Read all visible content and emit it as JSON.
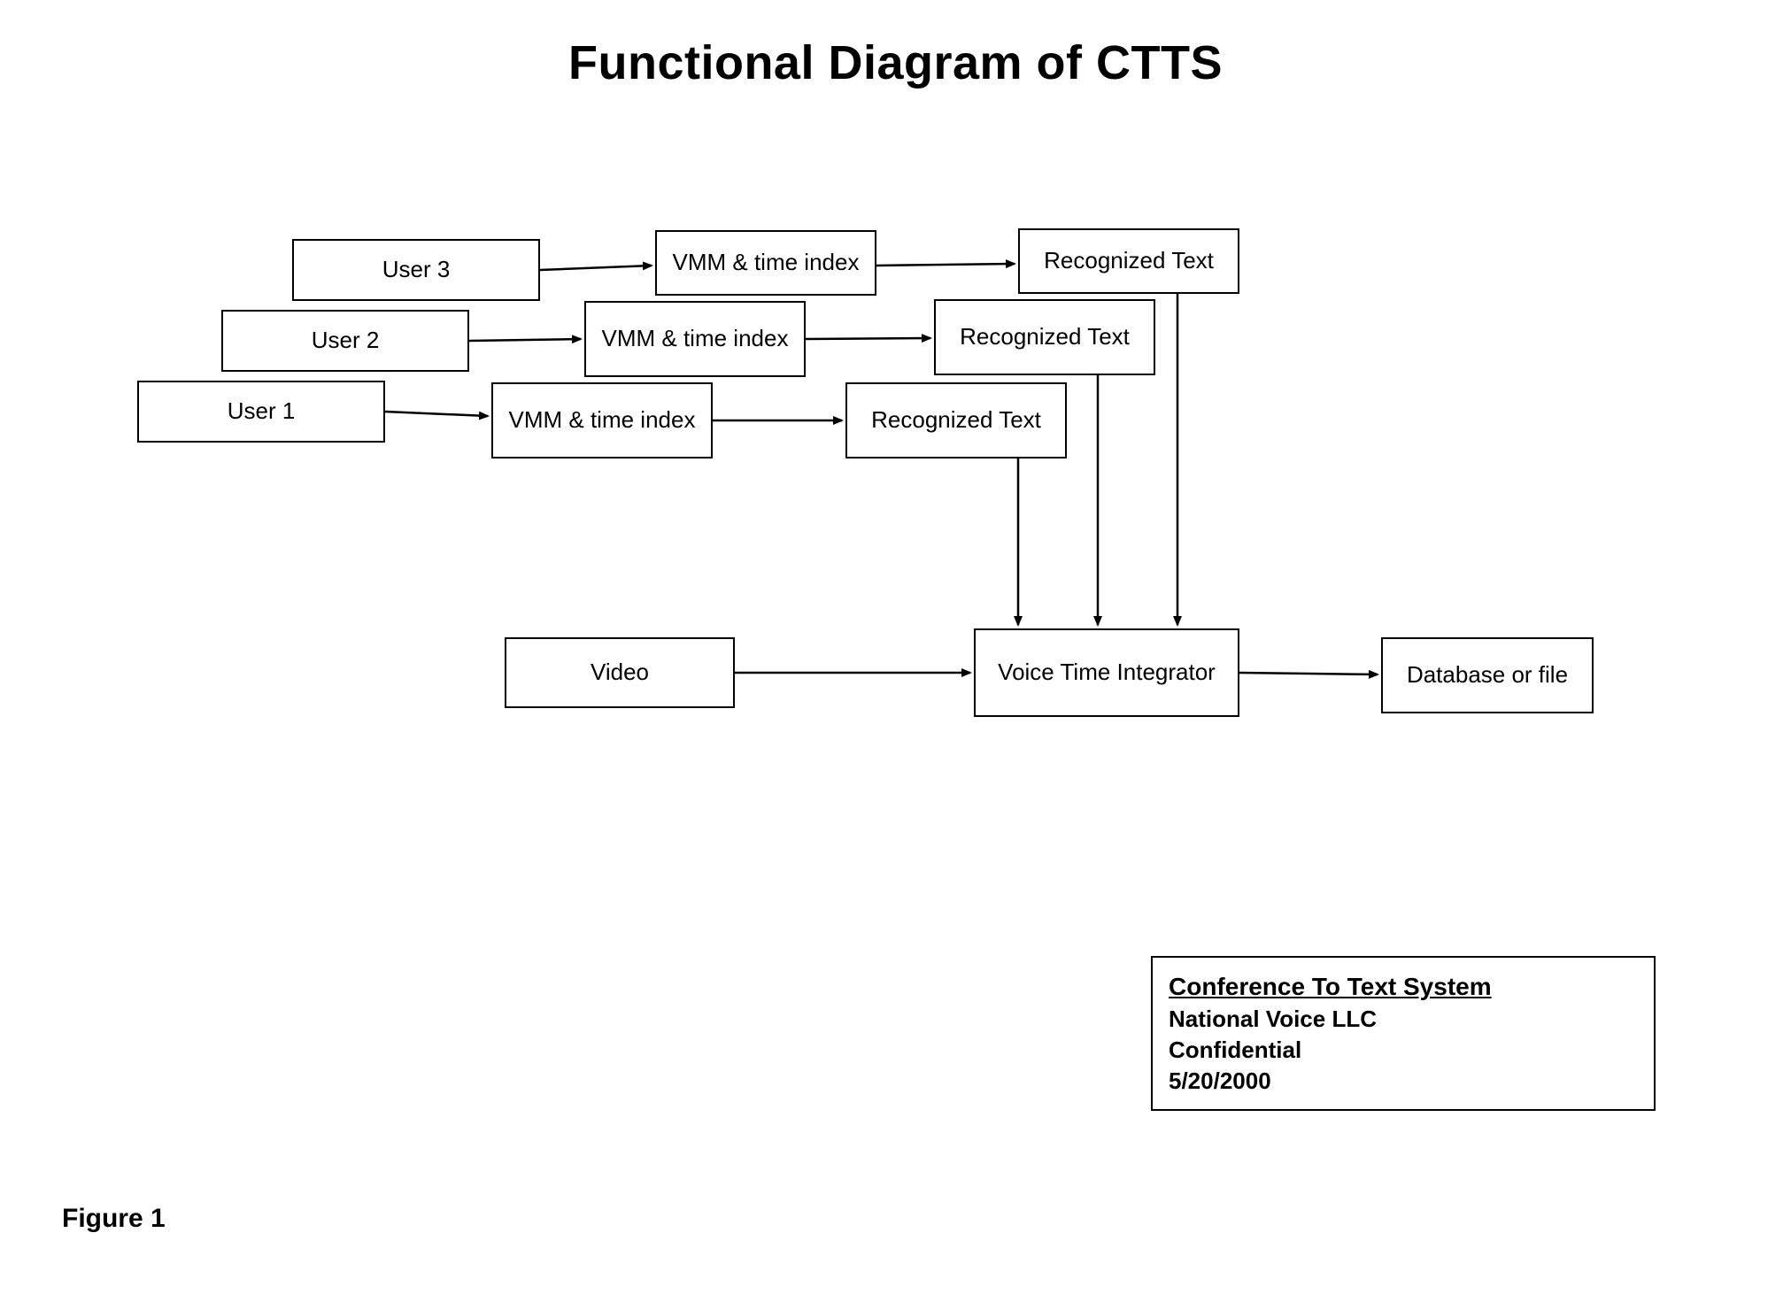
{
  "title": "Functional Diagram of CTTS",
  "nodes": {
    "user3": "User 3",
    "user2": "User 2",
    "user1": "User 1",
    "vmm3": "VMM & time index",
    "vmm2": "VMM & time index",
    "vmm1": "VMM & time index",
    "rec3": "Recognized Text",
    "rec2": "Recognized Text",
    "rec1": "Recognized Text",
    "video": "Video",
    "vti": "Voice Time Integrator",
    "db": "Database or file"
  },
  "legend": {
    "title": "Conference To Text System",
    "org": "National Voice LLC",
    "conf": "Confidential",
    "date": "5/20/2000"
  },
  "figure_label": "Figure 1"
}
